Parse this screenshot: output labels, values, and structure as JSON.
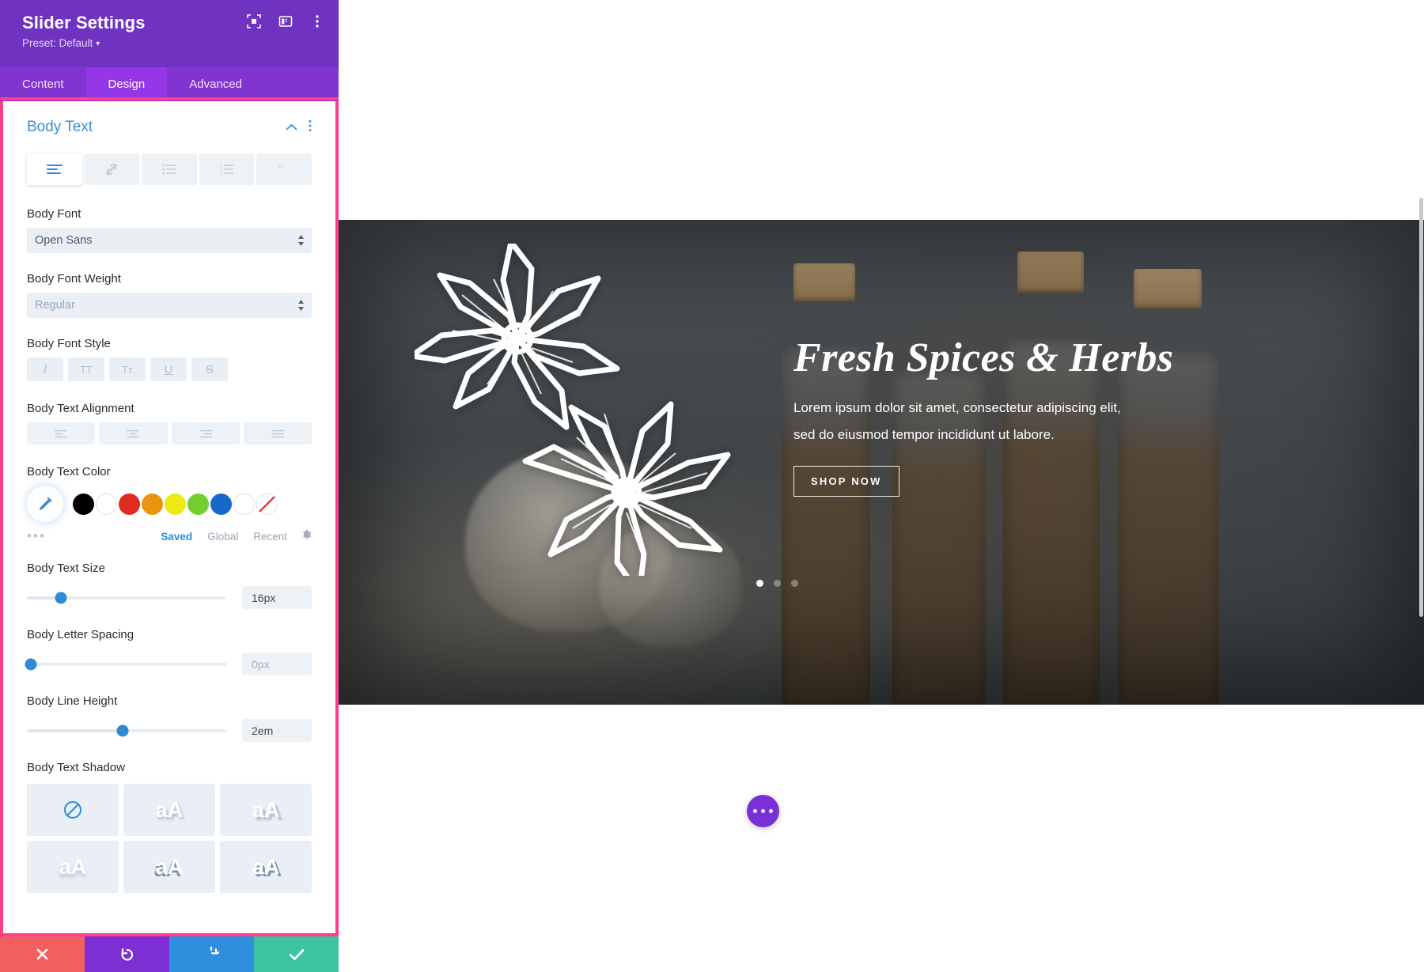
{
  "panel": {
    "title": "Slider Settings",
    "preset_label": "Preset: Default",
    "header_icons": [
      {
        "name": "focus-icon"
      },
      {
        "name": "panel-layout-icon"
      },
      {
        "name": "more-vertical-icon"
      }
    ],
    "tabs": [
      {
        "label": "Content",
        "active": false
      },
      {
        "label": "Design",
        "active": true
      },
      {
        "label": "Advanced",
        "active": false
      }
    ],
    "section": {
      "title": "Body Text",
      "collapse_icon": "chevron-up-icon",
      "menu_icon": "more-vertical-icon",
      "type_tabs": [
        {
          "name": "body-text-tab",
          "icon": "text-lines-icon",
          "active": true
        },
        {
          "name": "link-tab",
          "icon": "link-slash-icon",
          "active": false
        },
        {
          "name": "unordered-list-tab",
          "icon": "bullet-list-icon",
          "active": false
        },
        {
          "name": "ordered-list-tab",
          "icon": "numbered-list-icon",
          "active": false
        },
        {
          "name": "blockquote-tab",
          "icon": "quote-icon",
          "active": false
        }
      ]
    },
    "fields": {
      "body_font": {
        "label": "Body Font",
        "value": "Open Sans"
      },
      "body_font_weight": {
        "label": "Body Font Weight",
        "value": "Regular"
      },
      "body_font_style": {
        "label": "Body Font Style",
        "options": [
          {
            "glyph": "I",
            "name": "italic-button"
          },
          {
            "glyph": "TT",
            "name": "uppercase-button"
          },
          {
            "glyph": "Tᴛ",
            "name": "small-caps-button"
          },
          {
            "glyph": "U",
            "name": "underline-button"
          },
          {
            "glyph": "S",
            "name": "strikethrough-button"
          }
        ]
      },
      "body_text_alignment": {
        "label": "Body Text Alignment",
        "options": [
          {
            "name": "align-left-button"
          },
          {
            "name": "align-center-button"
          },
          {
            "name": "align-right-button"
          },
          {
            "name": "align-justify-button"
          }
        ]
      },
      "body_text_color": {
        "label": "Body Text Color",
        "eyedropper_icon": "eyedropper-icon",
        "swatches": [
          {
            "color": "#000000",
            "name": "swatch-black"
          },
          {
            "color": "#ffffff",
            "name": "swatch-white"
          },
          {
            "color": "#e02b20",
            "name": "swatch-red"
          },
          {
            "color": "#e8960f",
            "name": "swatch-orange"
          },
          {
            "color": "#edea14",
            "name": "swatch-yellow"
          },
          {
            "color": "#71cf2f",
            "name": "swatch-green"
          },
          {
            "color": "#1668ca",
            "name": "swatch-blue"
          },
          {
            "color": "#ffffff",
            "name": "swatch-white-2"
          },
          {
            "color": "transparent",
            "name": "swatch-transparent"
          }
        ],
        "more_dots": "•••",
        "links": [
          {
            "label": "Saved",
            "active": true
          },
          {
            "label": "Global",
            "active": false
          },
          {
            "label": "Recent",
            "active": false
          }
        ],
        "gear_icon": "gear-icon"
      },
      "body_text_size": {
        "label": "Body Text Size",
        "value": "16px",
        "position_pct": 17,
        "placeholder": false
      },
      "body_letter_spacing": {
        "label": "Body Letter Spacing",
        "value": "0px",
        "position_pct": 2,
        "placeholder": true
      },
      "body_line_height": {
        "label": "Body Line Height",
        "value": "2em",
        "position_pct": 48,
        "placeholder": false
      },
      "body_text_shadow": {
        "label": "Body Text Shadow",
        "options": [
          {
            "name": "shadow-none-button",
            "glyph": "⊘",
            "style": "none"
          },
          {
            "name": "shadow-preset-1-button",
            "glyph": "aA",
            "style": "s1"
          },
          {
            "name": "shadow-preset-2-button",
            "glyph": "aA",
            "style": "s2"
          },
          {
            "name": "shadow-preset-3-button",
            "glyph": "aA",
            "style": "s3"
          },
          {
            "name": "shadow-preset-4-button",
            "glyph": "aA",
            "style": "s4"
          },
          {
            "name": "shadow-preset-5-button",
            "glyph": "aA",
            "style": "s5"
          }
        ]
      }
    },
    "footer": [
      {
        "name": "cancel-button",
        "icon": "close-icon",
        "glyph": "✕",
        "color": "#f15f5f"
      },
      {
        "name": "undo-button",
        "icon": "undo-icon",
        "glyph": "↺",
        "color": "#7e2fd4"
      },
      {
        "name": "redo-button",
        "icon": "redo-icon",
        "glyph": "↻",
        "color": "#2f8ede"
      },
      {
        "name": "save-button",
        "icon": "check-icon",
        "glyph": "✓",
        "color": "#3dc3a0"
      }
    ],
    "highlight_color": "#ff3d8b",
    "header_color": "#7032c0"
  },
  "preview": {
    "slide": {
      "title": "Fresh Spices & Herbs",
      "description_line1": "Lorem ipsum dolor sit amet, consectetur adipiscing elit,",
      "description_line2": "sed do eiusmod tempor incididunt ut labore.",
      "button_label": "SHOP NOW",
      "dots": [
        {
          "active": true
        },
        {
          "active": false
        },
        {
          "active": false
        }
      ]
    },
    "fab": {
      "name": "page-settings-fab",
      "icon": "ellipsis-icon"
    }
  }
}
